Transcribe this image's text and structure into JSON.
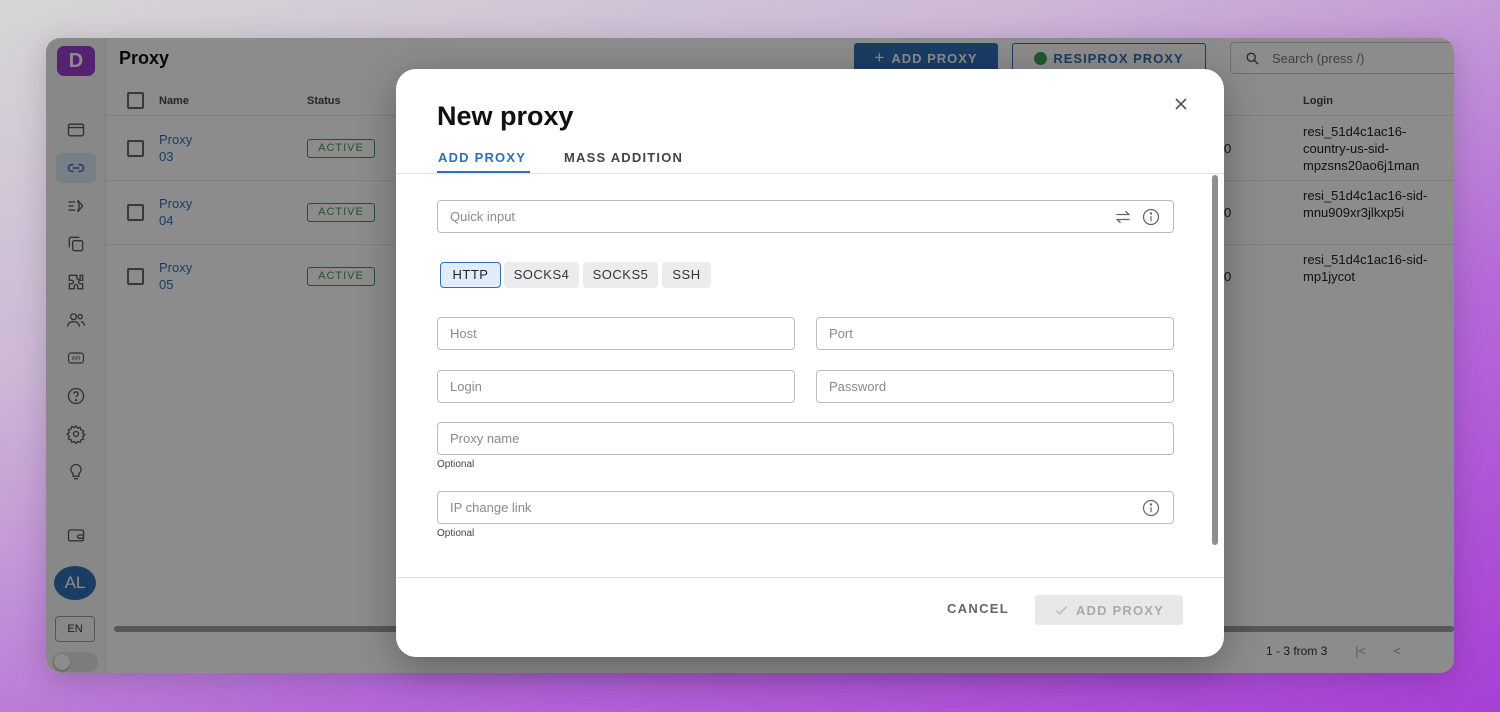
{
  "app": {
    "logo_letter": "D",
    "page_title": "Proxy"
  },
  "toolbar": {
    "add_proxy_label": "ADD PROXY",
    "resiprox_label": "RESIPROX PROXY",
    "search_placeholder": "Search (press /)"
  },
  "table": {
    "headers": {
      "name": "Name",
      "status": "Status",
      "login": "Login"
    },
    "rows": [
      {
        "name": "Proxy 03",
        "status": "ACTIVE",
        "count": "0",
        "login": "resi_51d4c1ac16-country-us-sid-mpzsns20ao6j1man"
      },
      {
        "name": "Proxy 04",
        "status": "ACTIVE",
        "count": "0",
        "login": "resi_51d4c1ac16-sid-mnu909xr3jlkxp5i"
      },
      {
        "name": "Proxy 05",
        "status": "ACTIVE",
        "count": "0",
        "login": "resi_51d4c1ac16-sid-mp1jycot"
      }
    ],
    "pagination": "1 - 3 from 3"
  },
  "sidebar": {
    "avatar_initials": "AL",
    "language": "EN"
  },
  "modal": {
    "title": "New proxy",
    "tabs": [
      {
        "label": "ADD PROXY",
        "active": true
      },
      {
        "label": "MASS ADDITION",
        "active": false
      }
    ],
    "quick_input_placeholder": "Quick input",
    "types": [
      "HTTP",
      "SOCKS4",
      "SOCKS5",
      "SSH"
    ],
    "selected_type": "HTTP",
    "host_placeholder": "Host",
    "port_placeholder": "Port",
    "login_placeholder": "Login",
    "password_placeholder": "Password",
    "proxy_name_placeholder": "Proxy name",
    "proxy_name_helper": "Optional",
    "ip_change_placeholder": "IP change link",
    "ip_change_helper": "Optional",
    "cancel_label": "CANCEL",
    "submit_label": "ADD PROXY"
  },
  "colors": {
    "accent": "#2f6fb6",
    "active_status": "#3a9a4e",
    "brand": "#9b3fd0"
  }
}
